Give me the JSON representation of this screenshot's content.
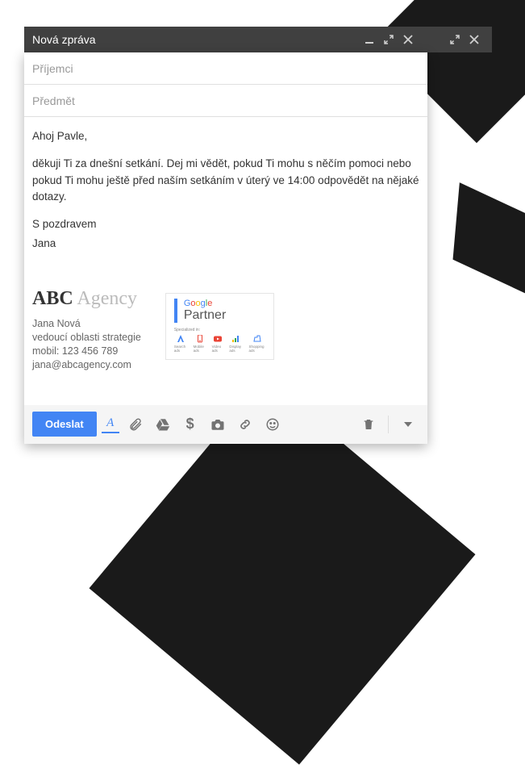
{
  "titlebar": {
    "title": "Nová zpráva"
  },
  "fields": {
    "recipients_placeholder": "Příjemci",
    "subject_placeholder": "Předmět"
  },
  "body": {
    "greeting": "Ahoj Pavle,",
    "paragraph": "děkuji Ti za dnešní setkání. Dej mi vědět, pokud Ti mohu s něčím pomoci nebo pokud Ti mohu ještě před naším setkáním v úterý ve 14:00 odpovědět na nějaké dotazy.",
    "closing": "S pozdravem",
    "name": "Jana"
  },
  "signature": {
    "company_bold": "ABC",
    "company_light": "Agency",
    "person": "Jana Nová",
    "role": "vedoucí oblasti strategie",
    "phone": "mobil: 123 456 789",
    "email": "jana@abcagency.com",
    "badge": {
      "brand": "Google",
      "label": "Partner",
      "specialized": "Specialized in:",
      "items": [
        "Search ads",
        "Mobile ads",
        "Video ads",
        "Display ads",
        "Shopping ads"
      ]
    }
  },
  "toolbar": {
    "send_label": "Odeslat",
    "format_label": "A"
  }
}
